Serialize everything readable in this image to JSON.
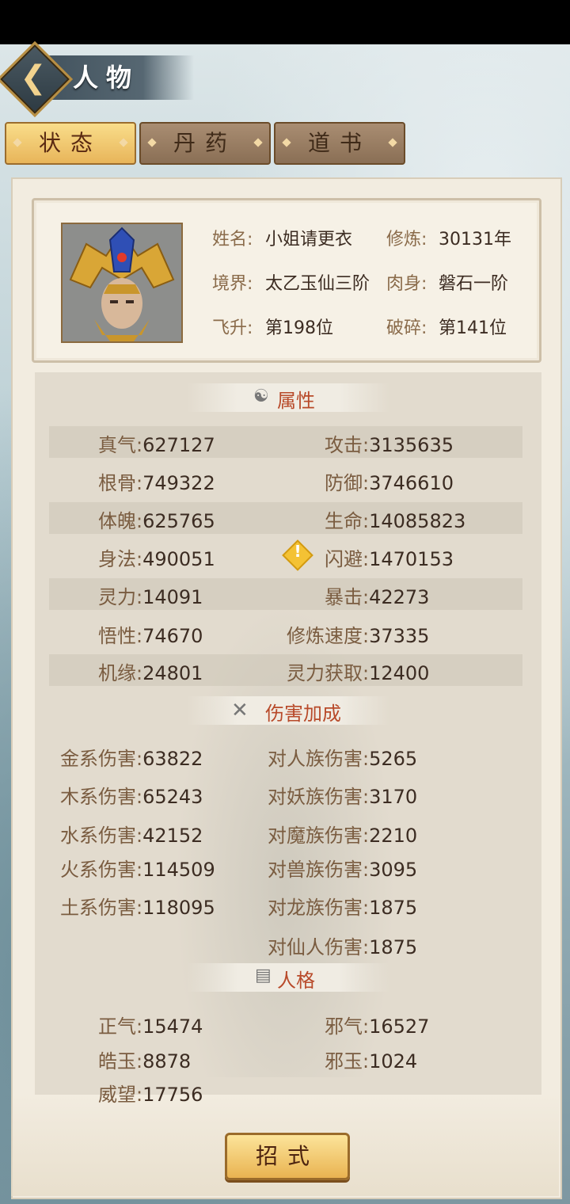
{
  "header": {
    "title": "人物"
  },
  "tabs": [
    {
      "label": "状态",
      "active": true
    },
    {
      "label": "丹药",
      "active": false
    },
    {
      "label": "道书",
      "active": false
    }
  ],
  "profile": {
    "name_label": "姓名:",
    "name_value": "小姐请更衣",
    "cultivate_label": "修炼:",
    "cultivate_value": "30131年",
    "realm_label": "境界:",
    "realm_value": "太乙玉仙三阶",
    "body_label": "肉身:",
    "body_value": "磐石一阶",
    "ascend_label": "飞升:",
    "ascend_value": "第198位",
    "break_label": "破碎:",
    "break_value": "第141位"
  },
  "attributes": {
    "title": "属性",
    "rows": [
      {
        "lk": "真气:",
        "lv": "627127",
        "rk": "攻击:",
        "rv": "3135635"
      },
      {
        "lk": "根骨:",
        "lv": "749322",
        "rk": "防御:",
        "rv": "3746610"
      },
      {
        "lk": "体魄:",
        "lv": "625765",
        "rk": "生命:",
        "rv": "14085823"
      },
      {
        "lk": "身法:",
        "lv": "490051",
        "rk": "闪避:",
        "rv": "1470153"
      },
      {
        "lk": "灵力:",
        "lv": "14091",
        "rk": "暴击:",
        "rv": "42273"
      },
      {
        "lk": "悟性:",
        "lv": "74670",
        "rk": "修炼速度:",
        "rv": "37335"
      },
      {
        "lk": "机缘:",
        "lv": "24801",
        "rk": "灵力获取:",
        "rv": "12400"
      }
    ]
  },
  "damage": {
    "title": "伤害加成",
    "rows": [
      {
        "lk": "金系伤害:",
        "lv": "63822",
        "rk": "对人族伤害:",
        "rv": "5265"
      },
      {
        "lk": "木系伤害:",
        "lv": "65243",
        "rk": "对妖族伤害:",
        "rv": "3170"
      },
      {
        "lk": "水系伤害:",
        "lv": "42152",
        "rk": "对魔族伤害:",
        "rv": "2210"
      },
      {
        "lk": "火系伤害:",
        "lv": "114509",
        "rk": "对兽族伤害:",
        "rv": "3095"
      },
      {
        "lk": "土系伤害:",
        "lv": "118095",
        "rk": "对龙族伤害:",
        "rv": "1875"
      },
      {
        "lk": "",
        "lv": "",
        "rk": "对仙人伤害:",
        "rv": "1875"
      }
    ]
  },
  "personality": {
    "title": "人格",
    "rows": [
      {
        "lk": "正气:",
        "lv": "15474",
        "rk": "邪气:",
        "rv": "16527"
      },
      {
        "lk": "皓玉:",
        "lv": "8878",
        "rk": "邪玉:",
        "rv": "1024"
      },
      {
        "lk": "威望:",
        "lv": "17756",
        "rk": "",
        "rv": ""
      }
    ]
  },
  "bottom": {
    "button_label": "招式"
  }
}
